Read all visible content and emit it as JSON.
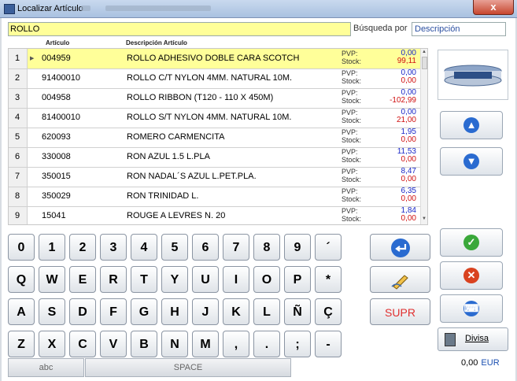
{
  "window": {
    "title": "Localizar Artículo",
    "close_label": "x"
  },
  "search": {
    "value": "ROLLO",
    "by_label": "Búsqueda por",
    "field_value": "Descripción"
  },
  "table": {
    "headers": {
      "code": "Artículo",
      "desc": "Descripción Artículo"
    },
    "pvp_label": "PVP:",
    "stock_label": "Stock:",
    "rows": [
      {
        "idx": "1",
        "code": "004959",
        "desc": "ROLLO ADHESIVO DOBLE CARA SCOTCH",
        "pvp": "0,00",
        "stock": "99,11",
        "selected": true
      },
      {
        "idx": "2",
        "code": "91400010",
        "desc": "ROLLO C/T NYLON 4MM. NATURAL 10M.",
        "pvp": "0,00",
        "stock": "0,00"
      },
      {
        "idx": "3",
        "code": "004958",
        "desc": "ROLLO RIBBON (T120 - 110 X 450M)",
        "pvp": "0,00",
        "stock": "-102,99"
      },
      {
        "idx": "4",
        "code": "81400010",
        "desc": "ROLLO S/T NYLON 4MM. NATURAL 10M.",
        "pvp": "0,00",
        "stock": "21,00"
      },
      {
        "idx": "5",
        "code": "620093",
        "desc": "ROMERO CARMENCITA",
        "pvp": "1,95",
        "stock": "0,00"
      },
      {
        "idx": "6",
        "code": "330008",
        "desc": "RON AZUL 1.5 L.PLA",
        "pvp": "11,53",
        "stock": "0,00"
      },
      {
        "idx": "7",
        "code": "350015",
        "desc": "RON NADAL´S AZUL L.PET.PLA.",
        "pvp": "8,47",
        "stock": "0,00"
      },
      {
        "idx": "8",
        "code": "350029",
        "desc": "RON TRINIDAD L.",
        "pvp": "6,35",
        "stock": "0,00"
      },
      {
        "idx": "9",
        "code": "15041",
        "desc": "ROUGE A LEVRES N. 20",
        "pvp": "1,84",
        "stock": "0,00"
      }
    ]
  },
  "keyboard": {
    "row1": [
      "0",
      "1",
      "2",
      "3",
      "4",
      "5",
      "6",
      "7",
      "8",
      "9",
      "´"
    ],
    "row2": [
      "Q",
      "W",
      "E",
      "R",
      "T",
      "Y",
      "U",
      "I",
      "O",
      "P",
      "*"
    ],
    "row3": [
      "A",
      "S",
      "D",
      "F",
      "G",
      "H",
      "J",
      "K",
      "L",
      "Ñ",
      "Ç"
    ],
    "row4": [
      "Z",
      "X",
      "C",
      "V",
      "B",
      "N",
      "M",
      ",",
      ".",
      ";",
      "-"
    ],
    "supr_label": "SUPR",
    "abc_label": "abc",
    "space_label": "SPACE"
  },
  "side": {
    "divisa_label": "Divisa"
  },
  "footer": {
    "amount": "0,00",
    "currency": "EUR"
  },
  "colors": {
    "selected_row": "#ffff99",
    "pvp": "#1a28c8",
    "stock": "#d01010",
    "ok": "#3aa83a",
    "cancel": "#d9421f",
    "arrows": "#2a6bd0"
  },
  "icons": [
    "enter-icon",
    "edit-pencil-icon",
    "page-up-icon",
    "page-down-icon",
    "ok-check-icon",
    "cancel-x-icon",
    "keyboard-icon",
    "calculator-icon"
  ]
}
